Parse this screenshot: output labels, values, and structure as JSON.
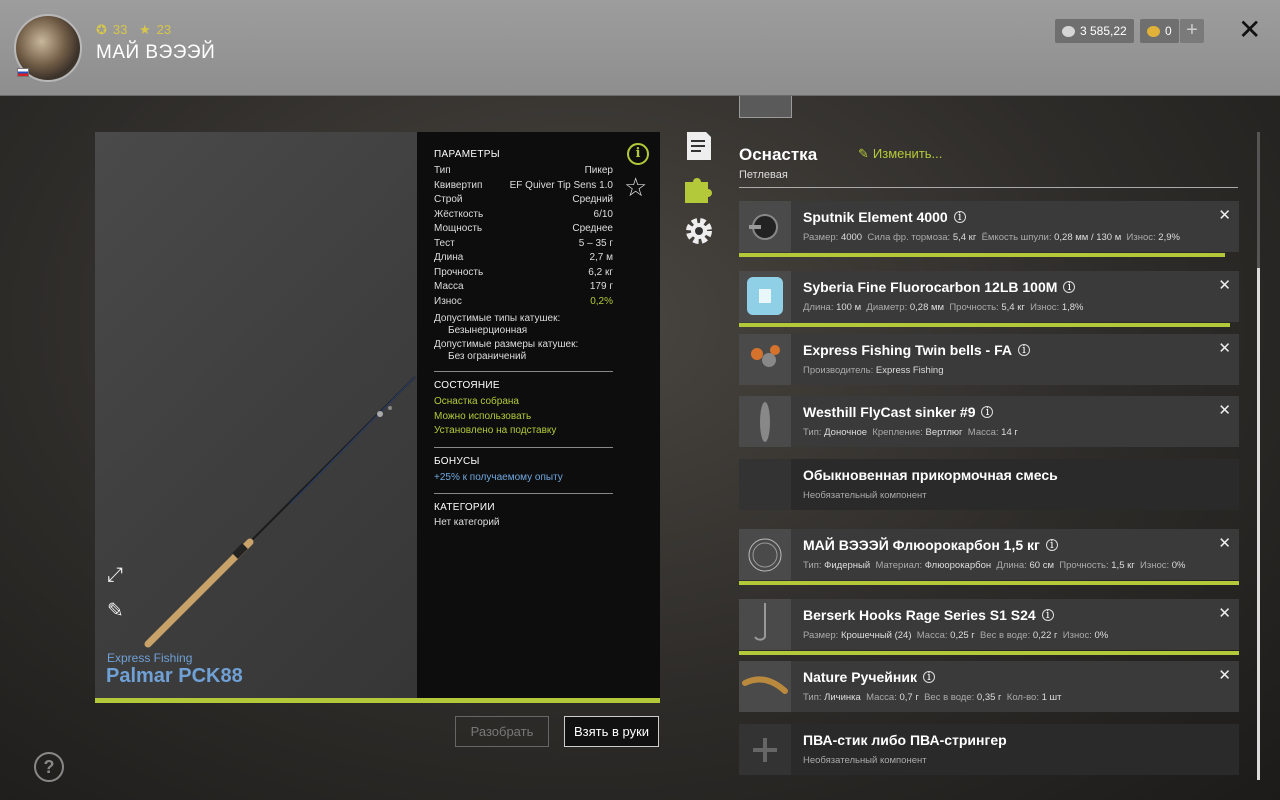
{
  "header": {
    "level": "33",
    "rating": "23",
    "player_name": "МАЙ ВЭЭЭЙ",
    "silver": "3 585,22",
    "gold": "0",
    "plus": "+",
    "close": "✕"
  },
  "rod": {
    "brand": "Express Fishing",
    "name": "Palmar PCK88"
  },
  "params": {
    "title": "ПАРАМЕТРЫ",
    "rows": [
      {
        "label": "Тип",
        "value": "Пикер"
      },
      {
        "label": "Квивертип",
        "value": "EF Quiver Tip Sens 1.0"
      },
      {
        "label": "Строй",
        "value": "Средний"
      },
      {
        "label": "Жёсткость",
        "value": "6/10"
      },
      {
        "label": "Мощность",
        "value": "Среднее"
      },
      {
        "label": "Тест",
        "value": "5 – 35 г"
      },
      {
        "label": "Длина",
        "value": "2,7 м"
      },
      {
        "label": "Прочность",
        "value": "6,2 кг"
      },
      {
        "label": "Масса",
        "value": "179 г"
      },
      {
        "label": "Износ",
        "value": "0,2%"
      }
    ],
    "reel_types_label": "Допустимые типы катушек:",
    "reel_types_value": "Безынерционная",
    "reel_sizes_label": "Допустимые размеры катушек:",
    "reel_sizes_value": "Без ограничений",
    "state_title": "СОСТОЯНИЕ",
    "state": [
      "Оснастка собрана",
      "Можно использовать",
      "Установлено на подставку"
    ],
    "bonus_title": "БОНУСЫ",
    "bonus": "+25% к получаемому опыту",
    "categories_title": "КАТЕГОРИИ",
    "categories": "Нет категорий"
  },
  "buttons": {
    "disassemble": "Разобрать",
    "take": "Взять в руки",
    "help": "?"
  },
  "tackle": {
    "title": "Оснастка",
    "edit": "Изменить...",
    "subtitle": "Петлевая",
    "items": [
      {
        "name": "Sputnik Element 4000",
        "d": [
          [
            "Размер:",
            "4000"
          ],
          [
            "Сила фр. тормоза:",
            "5,4 кг"
          ],
          [
            "Ёмкость шпули:",
            "0,28 мм / 130 м"
          ],
          [
            "Износ:",
            "2,9%"
          ]
        ],
        "wear": 0.971
      },
      {
        "name": "Syberia Fine Fluorocarbon 12LB 100M",
        "d": [
          [
            "Длина:",
            "100 м"
          ],
          [
            "Диаметр:",
            "0,28 мм"
          ],
          [
            "Прочность:",
            "5,4 кг"
          ],
          [
            "Износ:",
            "1,8%"
          ]
        ],
        "wear": 0.982
      },
      {
        "name": "Express Fishing Twin bells - FA",
        "d": [
          [
            "Производитель:",
            "Express Fishing"
          ]
        ]
      },
      {
        "name": "Westhill FlyCast sinker #9",
        "d": [
          [
            "Тип:",
            "Доночное"
          ],
          [
            "Крепление:",
            "Вертлюг"
          ],
          [
            "Масса:",
            "14 г"
          ]
        ]
      },
      {
        "name": "Обыкновенная прикормочная смесь",
        "optional": "Необязательный компонент"
      },
      {
        "name": "МАЙ ВЭЭЭЙ Флюорокарбон 1,5 кг",
        "d": [
          [
            "Тип:",
            "Фидерный"
          ],
          [
            "Материал:",
            "Флюорокарбон"
          ],
          [
            "Длина:",
            "60 см"
          ],
          [
            "Прочность:",
            "1,5 кг"
          ],
          [
            "Износ:",
            "0%"
          ]
        ],
        "wear": 1.0
      },
      {
        "name": "Berserk Hooks Rage Series S1 S24",
        "d": [
          [
            "Размер:",
            "Крошечный (24)"
          ],
          [
            "Масса:",
            "0,25 г"
          ],
          [
            "Вес в воде:",
            "0,22 г"
          ],
          [
            "Износ:",
            "0%"
          ]
        ],
        "wear": 1.0
      },
      {
        "name": "Nature Ручейник",
        "d": [
          [
            "Тип:",
            "Личинка"
          ],
          [
            "Масса:",
            "0,7 г"
          ],
          [
            "Вес в воде:",
            "0,35 г"
          ],
          [
            "Кол-во:",
            "1 шт"
          ]
        ]
      },
      {
        "name": "ПВА-стик либо ПВА-стрингер",
        "optional": "Необязательный компонент"
      }
    ]
  },
  "colors": {
    "accent": "#b3c93a",
    "link_blue": "#6fa0d6"
  }
}
